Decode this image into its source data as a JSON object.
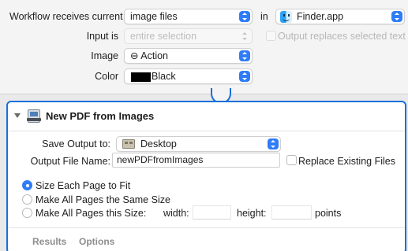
{
  "workflow": {
    "receives_label": "Workflow receives current",
    "receives_value": "image files",
    "in_label": "in",
    "app_value": "Finder.app",
    "input_is_label": "Input is",
    "input_is_value": "entire selection",
    "output_replaces_label": "Output replaces selected text",
    "image_label": "Image",
    "image_value": "⊖ Action",
    "color_label": "Color",
    "color_value": "Black",
    "color_swatch": "#000000"
  },
  "action": {
    "title": "New PDF from Images",
    "save_output_label": "Save Output to:",
    "save_output_value": "Desktop",
    "output_file_label": "Output File Name:",
    "output_file_value": "newPDFfromImages",
    "replace_existing_label": "Replace Existing Files",
    "size_options": [
      "Size Each Page to Fit",
      "Make All Pages the Same Size",
      "Make All Pages this Size:"
    ],
    "width_label": "width:",
    "height_label": "height:",
    "points_label": "points",
    "tabs": [
      "Results",
      "Options"
    ]
  },
  "colors": {
    "accent": "#2f7cf6",
    "selection_border": "#1b6fd9"
  }
}
